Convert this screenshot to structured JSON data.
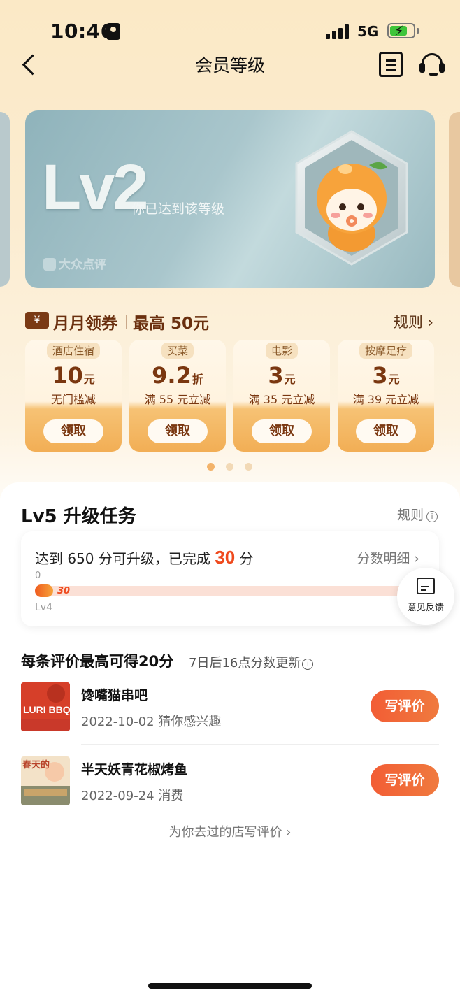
{
  "status_bar": {
    "time": "10:46",
    "network": "5G"
  },
  "nav": {
    "title": "会员等级"
  },
  "level_card": {
    "level": "Lv2",
    "subtitle": "你已达到该等级",
    "brand": "大众点评"
  },
  "coupons": {
    "title": "月月领券",
    "max": "最高 50元",
    "rule": "规则 ›",
    "items": [
      {
        "tag": "酒店住宿",
        "amount": "10",
        "unit": "元",
        "condition": "无门槛减",
        "button": "领取"
      },
      {
        "tag": "买菜",
        "amount": "9.2",
        "unit": "折",
        "condition": "满 55 元立减",
        "button": "领取"
      },
      {
        "tag": "电影",
        "amount": "3",
        "unit": "元",
        "condition": "满 35 元立减",
        "button": "领取"
      },
      {
        "tag": "按摩足疗",
        "amount": "3",
        "unit": "元",
        "condition": "满 39 元立减",
        "button": "领取"
      }
    ],
    "page_count": 3,
    "active_page": 1
  },
  "task": {
    "title": "Lv5 升级任务",
    "rule": "规则",
    "progress_prefix": "达到 650 分可升级，已完成",
    "progress_done": "30",
    "progress_suffix": "分",
    "detail": "分数明细 ›",
    "min_label": "0",
    "current_value_label": "30",
    "current_level": "Lv4",
    "progress_fraction": 0.046
  },
  "feedback": {
    "label": "意见反馈"
  },
  "reviews": {
    "title": "每条评价最高可得20分",
    "subtitle": "7日后16点分数更新",
    "items": [
      {
        "name": "馋嘴猫串吧",
        "meta": "2022-10-02 猜你感兴趣",
        "button": "写评价",
        "thumb_text": "LURI BBQ"
      },
      {
        "name": "半天妖青花椒烤鱼",
        "meta": "2022-09-24 消费",
        "button": "写评价",
        "thumb_text": "春天的"
      }
    ],
    "more": "为你去过的店写评价 ›"
  }
}
